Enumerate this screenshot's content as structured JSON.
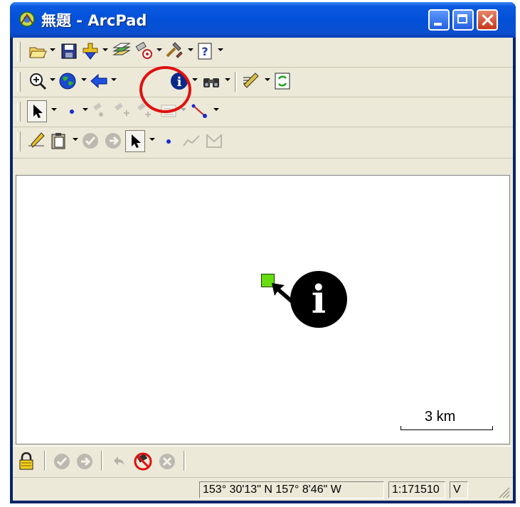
{
  "window": {
    "title": "無題 - ArcPad",
    "title_color": "#ffffff",
    "titlebar_color": "#0250d8"
  },
  "toolbars": {
    "file": [
      "open-icon",
      "save-icon",
      "add-layer-icon",
      "layers-icon",
      "gps-icon",
      "tools-icon",
      "help-icon"
    ],
    "navigation": [
      "zoom-in-icon",
      "globe-icon",
      "back-arrow-icon",
      "identify-icon",
      "find-icon",
      "edit-pen-icon",
      "refresh-icon"
    ],
    "selection": [
      "select-arrow-icon",
      "point-icon",
      "gps-point-icon",
      "gps-vertex-icon",
      "gps-avg-icon",
      "attributes-icon",
      "polyline-icon"
    ],
    "edit": [
      "pencil-icon",
      "clipboard-icon",
      "check-icon",
      "forward-icon",
      "select-arrow-icon",
      "point-icon",
      "polyline-icon",
      "polygon-icon"
    ]
  },
  "map": {
    "background": "#ffffff",
    "feature_color": "#66dd11",
    "scale_label": "3 km"
  },
  "callout": {
    "label": "i",
    "highlight_color": "#e01010"
  },
  "bottom_toolbar": [
    "lock-icon",
    "check-icon",
    "forward-icon",
    "undo-icon",
    "no-gps-icon",
    "cancel-icon"
  ],
  "status": {
    "coordinates": "153°  30'13\" N 157°  8'46\" W",
    "scale": "1:171510",
    "mode": "V"
  }
}
